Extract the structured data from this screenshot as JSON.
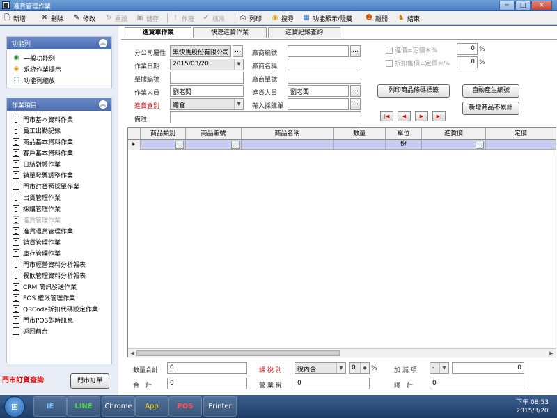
{
  "window": {
    "title": "進貨管理作業",
    "min": "─",
    "max": "□",
    "close": "✕"
  },
  "toolbar": [
    {
      "label": "新增",
      "icon": "new-doc-icon",
      "glyph": "🗋",
      "enabled": true
    },
    {
      "label": "刪除",
      "icon": "delete-icon",
      "glyph": "✕",
      "enabled": true
    },
    {
      "label": "修改",
      "icon": "edit-icon",
      "glyph": "✎",
      "enabled": true
    },
    {
      "label": "重設",
      "icon": "reset-icon",
      "glyph": "↻",
      "enabled": false
    },
    {
      "label": "儲存",
      "icon": "save-icon",
      "glyph": "▣",
      "enabled": false
    },
    {
      "label": "作廢",
      "icon": "void-icon",
      "glyph": "!",
      "enabled": false
    },
    {
      "label": "核准",
      "icon": "approve-icon",
      "glyph": "✔",
      "enabled": false
    },
    {
      "label": "列印",
      "icon": "print-icon",
      "glyph": "⎙",
      "enabled": true
    },
    {
      "label": "搜尋",
      "icon": "search-bulb-icon",
      "glyph": "◉",
      "enabled": true
    },
    {
      "label": "功能顯示/隱藏",
      "icon": "toggle-panel-icon",
      "glyph": "▦",
      "enabled": true
    },
    {
      "label": "離開",
      "icon": "exit-icon",
      "glyph": "☻",
      "enabled": true
    },
    {
      "label": "結束",
      "icon": "end-icon",
      "glyph": "♞",
      "enabled": true
    }
  ],
  "sidebar": {
    "function_panel": {
      "title": "功能列",
      "items": [
        "一般功能列",
        "系統作業提示",
        "功能列縮放"
      ]
    },
    "tasks_panel": {
      "title": "作業項目",
      "items": [
        {
          "label": "門市基本資料作業",
          "enabled": true
        },
        {
          "label": "員工出勤記錄",
          "enabled": true
        },
        {
          "label": "商品基本資料作業",
          "enabled": true
        },
        {
          "label": "客戶基本資料作業",
          "enabled": true
        },
        {
          "label": "日結對帳作業",
          "enabled": true
        },
        {
          "label": "銷單發票調整作業",
          "enabled": true
        },
        {
          "label": "門市訂貨預採單作業",
          "enabled": true
        },
        {
          "label": "出貨管理作業",
          "enabled": true
        },
        {
          "label": "採購管理作業",
          "enabled": true
        },
        {
          "label": "進貨管理作業",
          "enabled": false
        },
        {
          "label": "進貨退貨管理作業",
          "enabled": true
        },
        {
          "label": "銷貨管理作業",
          "enabled": true
        },
        {
          "label": "庫存管理作業",
          "enabled": true
        },
        {
          "label": "門市經營資料分析報表",
          "enabled": true
        },
        {
          "label": "餐飲管理資料分析報表",
          "enabled": true
        },
        {
          "label": "CRM 簡訊發送作業",
          "enabled": true
        },
        {
          "label": "POS 權限管理作業",
          "enabled": true
        },
        {
          "label": "QRCode折扣代碼設定作業",
          "enabled": true
        },
        {
          "label": "門市POS即時訊息",
          "enabled": true
        },
        {
          "label": "返回前台",
          "enabled": true
        }
      ]
    },
    "order_query": "門市訂貨查詢",
    "store_order_button": "門市訂單"
  },
  "tabs": [
    "進貨單作業",
    "快速進貨作業",
    "進貨紀錄查詢"
  ],
  "form": {
    "branch_label": "分公司屬性",
    "branch_value": "黑快馬股份有限公司",
    "date_label": "作業日期",
    "date_value": "2015/03/20",
    "doc_no_label": "單據編號",
    "doc_no_value": "",
    "operator_label": "作業人員",
    "operator_value": "劉老闆",
    "category_label": "進貨倉別",
    "category_value": "總倉",
    "note_label": "備註",
    "note_value": "",
    "vendor_no_label": "廠商編號",
    "vendor_no_value": "",
    "vendor_name_label": "廠商名稱",
    "vendor_name_value": "",
    "vendor_doc_label": "廠商單號",
    "vendor_doc_value": "",
    "receiver_label": "進貨人員",
    "receiver_value": "劉老闆",
    "import_po_label": "帶入採購單",
    "import_po_value": "",
    "price_ratio_label": "進價=定價＊%",
    "price_ratio_value": "0",
    "discount_label": "折扣售價=定價＊%",
    "discount_value": "0",
    "percent": "%",
    "print_barcode_button": "列印商品條碼標籤",
    "auto_number_button": "自動產生編號",
    "no_accumulate_button": "新增商品不累計",
    "nav": [
      "|◀",
      "◀",
      "▶",
      "▶|"
    ]
  },
  "grid": {
    "columns": [
      "商品類別",
      "商品編號",
      "商品名稱",
      "數量",
      "單位",
      "進貨價",
      "定價"
    ],
    "row": {
      "marker": "▸",
      "dots": "...",
      "unit": "份"
    }
  },
  "footer": {
    "qty_total_label": "數量合計",
    "qty_total_value": "0",
    "total_label": "合　計",
    "total_value": "0",
    "tax_type_label": "課 稅 別",
    "tax_type_value": "稅內含",
    "tax_rate_value": "0",
    "tax_rate_unit": "%",
    "business_tax_label": "營 業 稅",
    "business_tax_value": "0",
    "adjust_label": "加 減 項",
    "adjust_sign": "-",
    "adjust_value": "0",
    "grand_total_label": "總　計",
    "grand_total_value": "0"
  },
  "taskbar": {
    "apps": [
      "IE",
      "LINE",
      "Chrome",
      "App",
      "POS",
      "Printer"
    ],
    "time": "下午 08:53",
    "date": "2015/3/20"
  }
}
